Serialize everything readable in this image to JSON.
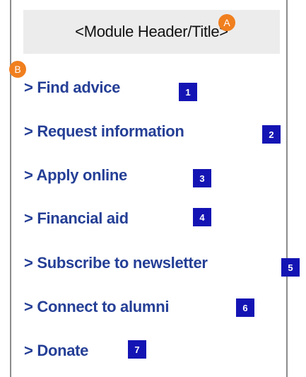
{
  "header": {
    "title": "<Module Header/Title>"
  },
  "markers": {
    "a": "A",
    "b": "B"
  },
  "links": [
    {
      "label": "> Find advice",
      "badge": "1"
    },
    {
      "label": "> Request information",
      "badge": "2"
    },
    {
      "label": "> Apply online",
      "badge": "3"
    },
    {
      "label": "> Financial aid",
      "badge": "4"
    },
    {
      "label": "> Subscribe to newsletter",
      "badge": "5"
    },
    {
      "label": "> Connect to alumni",
      "badge": "6"
    },
    {
      "label": "> Donate",
      "badge": "7"
    }
  ],
  "colors": {
    "link": "#253f96",
    "badge": "#1414b4",
    "marker": "#f07f1e",
    "header_bg": "#ececec",
    "border": "#8c8c8c"
  }
}
